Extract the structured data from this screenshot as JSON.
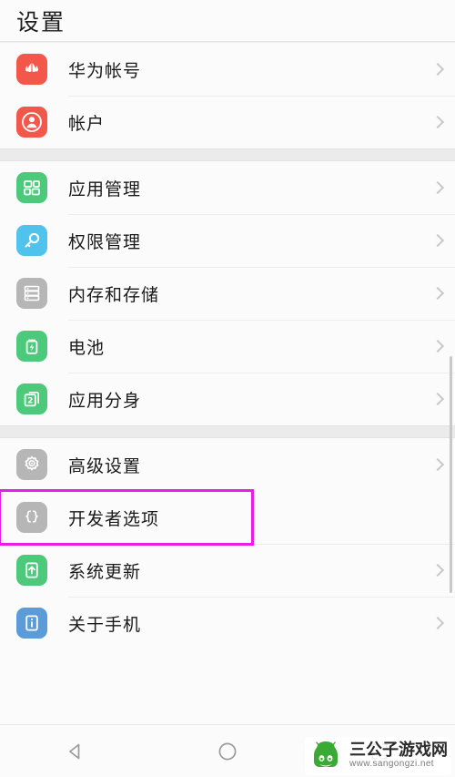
{
  "header": {
    "title": "设置"
  },
  "colors": {
    "huawei_red": "#F3574A",
    "account_red": "#F3574A",
    "app_green": "#4CC97A",
    "permission_blue": "#4FC3EC",
    "storage_gray": "#B6B6B6",
    "battery_green": "#4CC97A",
    "twin_green": "#4CC97A",
    "advanced_gray": "#B6B6B6",
    "developer_gray": "#B6B6B6",
    "update_green": "#4CC97A",
    "about_blue": "#5A9BD8",
    "highlight": "#E81EE8",
    "chevron": "#C9C9C9",
    "page_bg": "#FBFBFB",
    "gap_bg": "#EBEBEB"
  },
  "groups": [
    {
      "rows": [
        {
          "label": "华为帐号",
          "icon": "huawei-logo-icon",
          "highlighted": false
        },
        {
          "label": "帐户",
          "icon": "account-person-icon",
          "highlighted": false
        }
      ]
    },
    {
      "rows": [
        {
          "label": "应用管理",
          "icon": "app-grid-icon",
          "highlighted": false
        },
        {
          "label": "权限管理",
          "icon": "key-icon",
          "highlighted": false
        },
        {
          "label": "内存和存储",
          "icon": "storage-server-icon",
          "highlighted": false
        },
        {
          "label": "电池",
          "icon": "battery-icon",
          "highlighted": false
        },
        {
          "label": "应用分身",
          "icon": "app-twin-icon",
          "highlighted": false
        }
      ]
    },
    {
      "rows": [
        {
          "label": "高级设置",
          "icon": "gear-icon",
          "highlighted": false
        },
        {
          "label": "开发者选项",
          "icon": "braces-icon",
          "highlighted": true
        },
        {
          "label": "系统更新",
          "icon": "system-update-icon",
          "highlighted": false
        },
        {
          "label": "关于手机",
          "icon": "info-icon",
          "highlighted": false
        }
      ]
    }
  ],
  "navbar": {
    "back": "back-triangle-icon",
    "home": "home-circle-icon",
    "recents": "recents-square-icon"
  },
  "watermark": {
    "title": "三公子游戏网",
    "url": "www.sangongzi.net",
    "logo": "android-robot-icon"
  }
}
